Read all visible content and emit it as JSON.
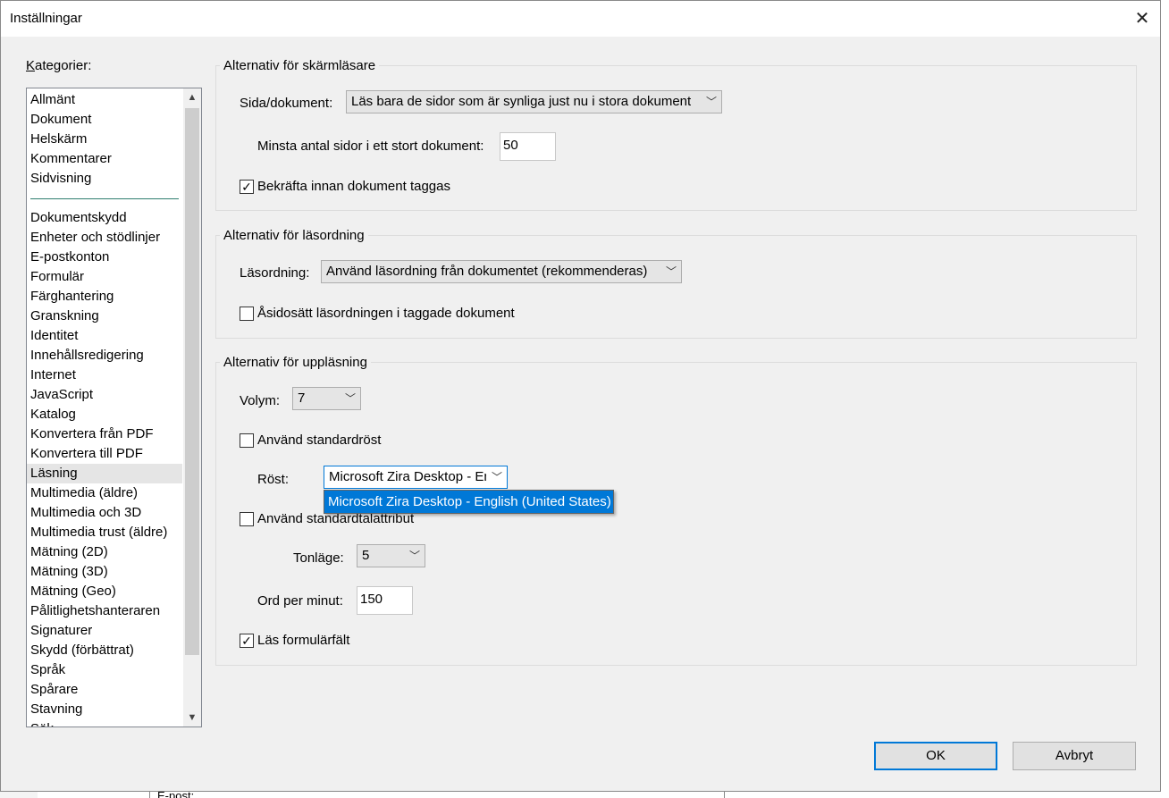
{
  "window": {
    "title": "Inställningar",
    "close_glyph": "✕"
  },
  "categories": {
    "label": "Kategorier:",
    "group1": [
      "Allmänt",
      "Dokument",
      "Helskärm",
      "Kommentarer",
      "Sidvisning"
    ],
    "group2": [
      "Dokumentskydd",
      "Enheter och stödlinjer",
      "E-postkonton",
      "Formulär",
      "Färghantering",
      "Granskning",
      "Identitet",
      "Innehållsredigering",
      "Internet",
      "JavaScript",
      "Katalog",
      "Konvertera från PDF",
      "Konvertera till PDF",
      "Läsning",
      "Multimedia (äldre)",
      "Multimedia och 3D",
      "Multimedia trust (äldre)",
      "Mätning (2D)",
      "Mätning (3D)",
      "Mätning (Geo)",
      "Pålitlighetshanteraren",
      "Signaturer",
      "Skydd (förbättrat)",
      "Språk",
      "Spårare",
      "Stavning",
      "Sök"
    ],
    "selected": "Läsning"
  },
  "screen_reader": {
    "title": "Alternativ för skärmläsare",
    "page_doc_label": "Sida/dokument:",
    "page_doc_value": "Läs bara de sidor som är synliga just nu i stora dokument",
    "min_pages_label": "Minsta antal sidor i ett stort dokument:",
    "min_pages_value": "50",
    "confirm_tag_label": "Bekräfta innan dokument taggas",
    "confirm_tag_checked": true
  },
  "reading_order": {
    "title": "Alternativ för läsordning",
    "order_label": "Läsordning:",
    "order_value": "Använd läsordning från dokumentet (rekommenderas)",
    "override_label": "Åsidosätt läsordningen i taggade dokument",
    "override_checked": false
  },
  "read_aloud": {
    "title": "Alternativ för uppläsning",
    "volume_label": "Volym:",
    "volume_value": "7",
    "default_voice_label": "Använd standardröst",
    "default_voice_checked": false,
    "voice_label": "Röst:",
    "voice_value": "Microsoft Zira Desktop - En",
    "voice_option": "Microsoft Zira Desktop - English (United States)",
    "default_speech_label": "Använd standardtalattribut",
    "default_speech_checked": false,
    "pitch_label": "Tonläge:",
    "pitch_value": "5",
    "wpm_label": "Ord per minut:",
    "wpm_value": "150",
    "read_form_label": "Läs formulärfält",
    "read_form_checked": true
  },
  "buttons": {
    "ok": "OK",
    "cancel": "Avbryt"
  },
  "background": {
    "bottom_text": "E-post:"
  },
  "icons": {
    "check": "✓",
    "chevron_down": "﹀",
    "scroll_up": "▲",
    "scroll_down": "▼"
  },
  "colors": {
    "accent": "#0078d7",
    "separator": "#2e7d6e"
  }
}
